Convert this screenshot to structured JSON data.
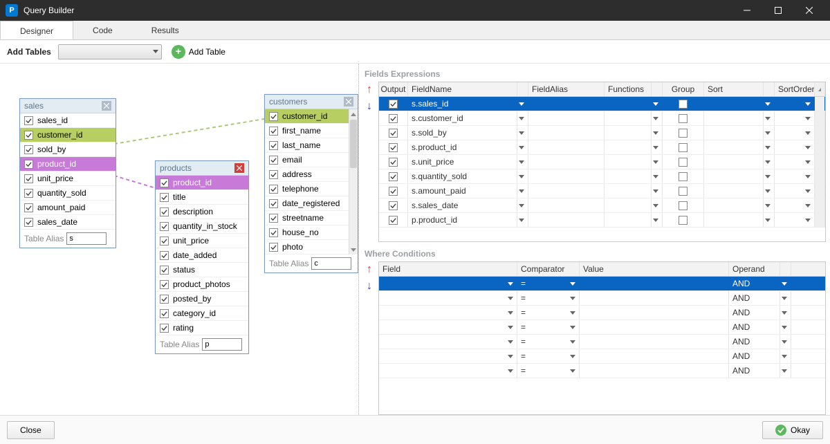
{
  "window": {
    "title": "Query Builder",
    "logo_letter": "P"
  },
  "tabs": {
    "designer": "Designer",
    "code": "Code",
    "results": "Results"
  },
  "toolbar": {
    "add_tables_label": "Add Tables",
    "add_table_btn": "Add Table"
  },
  "tables": {
    "sales": {
      "title": "sales",
      "alias_label": "Table Alias",
      "alias_value": "s",
      "fields": [
        "sales_id",
        "customer_id",
        "sold_by",
        "product_id",
        "unit_price",
        "quantity_sold",
        "amount_paid",
        "sales_date"
      ]
    },
    "products": {
      "title": "products",
      "alias_label": "Table Alias",
      "alias_value": "p",
      "fields": [
        "product_id",
        "title",
        "description",
        "quantity_in_stock",
        "unit_price",
        "date_added",
        "status",
        "product_photos",
        "posted_by",
        "category_id",
        "rating"
      ]
    },
    "customers": {
      "title": "customers",
      "alias_label": "Table Alias",
      "alias_value": "c",
      "fields": [
        "customer_id",
        "first_name",
        "last_name",
        "email",
        "address",
        "telephone",
        "date_registered",
        "streetname",
        "house_no",
        "photo"
      ]
    }
  },
  "fields_expressions": {
    "title": "Fields Expressions",
    "columns": {
      "output": "Output",
      "fieldname": "FieldName",
      "fieldalias": "FieldAlias",
      "functions": "Functions",
      "group": "Group",
      "sort": "Sort",
      "sortorder": "SortOrder"
    },
    "rows": [
      {
        "output": true,
        "fieldname": "s.sales_id"
      },
      {
        "output": true,
        "fieldname": "s.customer_id"
      },
      {
        "output": true,
        "fieldname": "s.sold_by"
      },
      {
        "output": true,
        "fieldname": "s.product_id"
      },
      {
        "output": true,
        "fieldname": "s.unit_price"
      },
      {
        "output": true,
        "fieldname": "s.quantity_sold"
      },
      {
        "output": true,
        "fieldname": "s.amount_paid"
      },
      {
        "output": true,
        "fieldname": "s.sales_date"
      },
      {
        "output": true,
        "fieldname": "p.product_id"
      }
    ]
  },
  "where_conditions": {
    "title": "Where Conditions",
    "columns": {
      "field": "Field",
      "comparator": "Comparator",
      "value": "Value",
      "operand": "Operand"
    },
    "default_comparator": "=",
    "default_operand": "AND",
    "row_count": 7
  },
  "footer": {
    "close": "Close",
    "okay": "Okay"
  }
}
